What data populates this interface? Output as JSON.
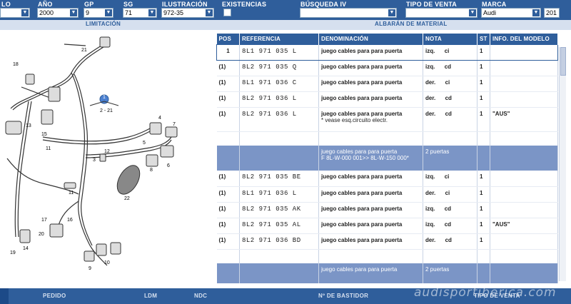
{
  "filters": {
    "lo": {
      "label": "LO",
      "value": ""
    },
    "anio": {
      "label": "AÑO",
      "value": "2000"
    },
    "gp": {
      "label": "GP",
      "value": "9"
    },
    "sg": {
      "label": "SG",
      "value": "71"
    },
    "ilustracion": {
      "label": "ILUSTRACIÓN",
      "value": "972-35"
    },
    "existencias": {
      "label": "EXISTENCIAS"
    },
    "busqueda": {
      "label": "BÚSQUEDA IV",
      "value": ""
    },
    "tipo_venta": {
      "label": "TIPO DE VENTA",
      "value": ""
    },
    "marca": {
      "label": "MARCA",
      "value": "Audi"
    },
    "year_partial": "201"
  },
  "sections": {
    "left": "LIMITACIÓN",
    "right": "ALBARÁN DE MATERIAL"
  },
  "table": {
    "headers": [
      "POS",
      "REFERENCIA",
      "DENOMINACIÓN",
      "NOTA",
      "ST",
      "INFO. DEL MODELO"
    ],
    "rows": [
      {
        "pos": "1",
        "ref": "8L1  971  035  L",
        "den": "juego cables para para puerta",
        "den2": "",
        "nota1": "izq.",
        "nota2": "ci",
        "st": "1",
        "info": ""
      },
      {
        "pos": "(1)",
        "ref": "8L2  971  035  Q",
        "den": "juego cables para para puerta",
        "den2": "",
        "nota1": "izq.",
        "nota2": "cd",
        "st": "1",
        "info": ""
      },
      {
        "pos": "(1)",
        "ref": "8L1  971  036  C",
        "den": "juego cables para para puerta",
        "den2": "",
        "nota1": "der.",
        "nota2": "ci",
        "st": "1",
        "info": ""
      },
      {
        "pos": "(1)",
        "ref": "8L2  971  036  L",
        "den": "juego cables para para puerta",
        "den2": "",
        "nota1": "der.",
        "nota2": "cd",
        "st": "1",
        "info": ""
      },
      {
        "pos": "(1)",
        "ref": "8L2  971  036  L",
        "den": "juego cables para para puerta",
        "den2": "* vease esq.circuito electr.",
        "nota1": "der.",
        "nota2": "cd",
        "st": "1",
        "info": "\"AUS\""
      }
    ],
    "group1": {
      "den": "juego cables para para puerta",
      "den2": "F 8L-W-000 001>> 8L-W-150 000*",
      "nota": "2 puertas"
    },
    "rows2": [
      {
        "pos": "(1)",
        "ref": "8L2  971  035  BE",
        "den": "juego cables para para puerta",
        "nota1": "izq.",
        "nota2": "ci",
        "st": "1",
        "info": ""
      },
      {
        "pos": "(1)",
        "ref": "8L1  971  036  L",
        "den": "juego cables para para puerta",
        "nota1": "der.",
        "nota2": "ci",
        "st": "1",
        "info": ""
      },
      {
        "pos": "(1)",
        "ref": "8L2  971  035  AK",
        "den": "juego cables para para puerta",
        "nota1": "izq.",
        "nota2": "cd",
        "st": "1",
        "info": ""
      },
      {
        "pos": "(1)",
        "ref": "8L2  971  035  AL",
        "den": "juego cables para para puerta",
        "nota1": "izq.",
        "nota2": "cd",
        "st": "1",
        "info": "\"AUS\""
      },
      {
        "pos": "(1)",
        "ref": "8L2  971  036  BD",
        "den": "juego cables para para puerta",
        "nota1": "der.",
        "nota2": "cd",
        "st": "1",
        "info": ""
      }
    ],
    "group2": {
      "den": "juego cables para para puerta",
      "nota": "2 puertas"
    }
  },
  "diagram_callouts": [
    "21",
    "18",
    "1",
    "2 - 21",
    "13",
    "15",
    "11",
    "3",
    "4",
    "5",
    "6",
    "7",
    "12",
    "8",
    "22",
    "11",
    "17",
    "16",
    "20",
    "9",
    "14",
    "19",
    "10"
  ],
  "bottom": {
    "pedido": "PEDIDO",
    "ldm": "LDM",
    "ndc": "NDC",
    "bastidor": "Nº DE BASTIDOR",
    "tipo_venta": "TIPO DE VENTA"
  },
  "watermark": "audisportiberica.com",
  "colors": {
    "bar": "#2f5e9b",
    "group_row": "#7b95c6",
    "section": "#d6e0ef"
  }
}
